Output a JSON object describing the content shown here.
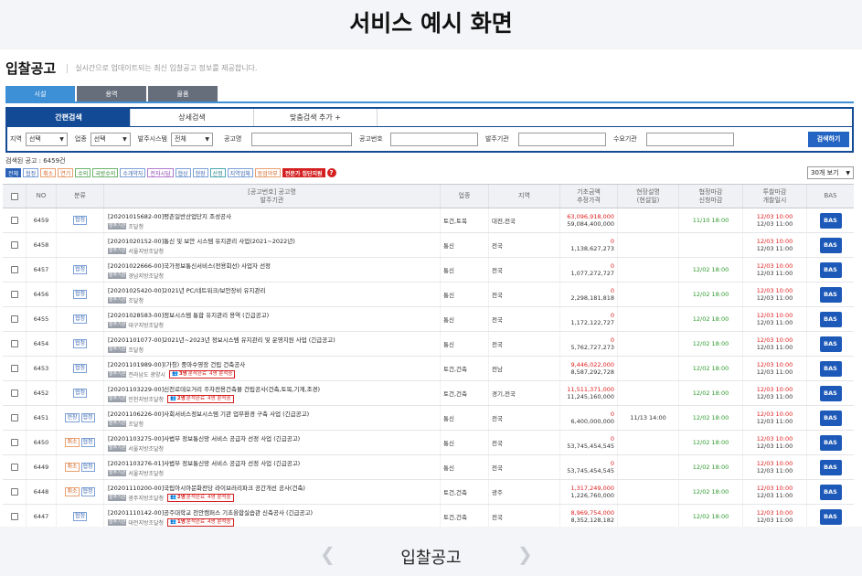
{
  "banner_title": "서비스 예시 화면",
  "page": {
    "title": "입찰공고",
    "description": "실시간으로 업데이트되는 최신 입찰공고 정보를 제공합니다."
  },
  "category_tabs": [
    "시설",
    "용역",
    "물품"
  ],
  "search_tabs": [
    "간편검색",
    "상세검색",
    "맞춤검색 추가 +"
  ],
  "filters": {
    "region_label": "지역",
    "region_value": "선택",
    "industry_label": "업종",
    "industry_value": "선택",
    "method_label": "발주시스템",
    "method_value": "전체",
    "notice_name_label": "공고명",
    "notice_no_label": "공고번호",
    "agency_label": "발주기관",
    "demand_label": "수요기관",
    "search_button": "검색하기"
  },
  "count_text": "검색된 공고 : 6459건",
  "chips": [
    "전체",
    "협정",
    "취소",
    "연기",
    "수의",
    "국방수의",
    "수개약자",
    "전자시담",
    "협상",
    "현장",
    "산정",
    "지역업체",
    "등업야부"
  ],
  "expert_chip": "전문가 집단지원",
  "qmark": "?",
  "per_page": "30개 보기",
  "table": {
    "headers": {
      "no": "NO",
      "category": "분류",
      "title_line1": "[공고번호] 공고명",
      "title_line2": "발주기관",
      "industry": "업종",
      "region": "지역",
      "price_line1": "기초금액",
      "price_line2": "추정가격",
      "site_line1": "현장설명",
      "site_line2": "(현설일)",
      "date_line1": "협정마감",
      "date_line2": "신청마감",
      "bid_line1": "투찰마감",
      "bid_line2": "개찰일시",
      "bas": "BAS"
    },
    "agency_badge": "발주기관",
    "bas_label": "BAS",
    "rows": [
      {
        "no": "6459",
        "tags": [
          {
            "t": "협정",
            "c": ""
          }
        ],
        "title": "[20201015682-00]평촌일반산업단지 조성공사",
        "agency": "조달청",
        "badge": null,
        "industry": "토건,토목",
        "region": "대전,전국",
        "price1": "63,096,918,000",
        "price2": "59,084,400,000",
        "site": "",
        "date": "11/10 18:00",
        "bid1": "12/03 10:00",
        "bid2": "12/03 11:00"
      },
      {
        "no": "6458",
        "tags": [],
        "title": "[20201020152-00]통신 및 보안 시스템 유지관리 사업(2021~2022년)",
        "agency": "서울지방조달청",
        "badge": null,
        "industry": "통신",
        "region": "전국",
        "price1": "0",
        "price2": "1,138,627,273",
        "site": "",
        "date": "",
        "bid1": "12/03 10:00",
        "bid2": "12/03 11:00"
      },
      {
        "no": "6457",
        "tags": [
          {
            "t": "협정",
            "c": ""
          }
        ],
        "title": "[20201022666-00]국가정보통신서비스(전용회선) 사업자 선정",
        "agency": "경남지방조달청",
        "badge": null,
        "industry": "통신",
        "region": "전국",
        "price1": "0",
        "price2": "1,077,272,727",
        "site": "",
        "date": "12/02 18:00",
        "bid1": "12/03 10:00",
        "bid2": "12/03 11:00"
      },
      {
        "no": "6456",
        "tags": [
          {
            "t": "협정",
            "c": ""
          }
        ],
        "title": "[20201025420-00]2021년 PC/네트워크/보안장비 유지관리",
        "agency": "조달청",
        "badge": null,
        "industry": "통신",
        "region": "전국",
        "price1": "0",
        "price2": "2,298,181,818",
        "site": "",
        "date": "12/02 18:00",
        "bid1": "12/03 10:00",
        "bid2": "12/03 11:00"
      },
      {
        "no": "6455",
        "tags": [
          {
            "t": "협정",
            "c": ""
          }
        ],
        "title": "[20201028583-00]정보시스템 통합 유지관리 용역 (긴급공고)",
        "agency": "대구지방조달청",
        "badge": null,
        "industry": "통신",
        "region": "전국",
        "price1": "0",
        "price2": "1,172,122,727",
        "site": "",
        "date": "12/02 18:00",
        "bid1": "12/03 10:00",
        "bid2": "12/03 11:00"
      },
      {
        "no": "6454",
        "tags": [
          {
            "t": "협정",
            "c": ""
          }
        ],
        "title": "[20201101077-00]2021년~2023년 정보시스템 유지관리 및 운영지원 사업 (긴급공고)",
        "agency": "조달청",
        "badge": null,
        "industry": "통신",
        "region": "전국",
        "price1": "0",
        "price2": "5,762,727,273",
        "site": "",
        "date": "12/02 18:00",
        "bid1": "12/03 10:00",
        "bid2": "12/03 11:00"
      },
      {
        "no": "6453",
        "tags": [
          {
            "t": "협정",
            "c": ""
          }
        ],
        "title": "[20201101989-00](가칭) 중마수영장 건립 건축공사",
        "agency": "전라남도 광양시",
        "badge": {
          "count": "3명",
          "a": "분석완료",
          "b": "4명 분석중"
        },
        "industry": "토건,건축",
        "region": "전남",
        "price1": "9,446,022,000",
        "price2": "8,587,292,728",
        "site": "",
        "date": "12/02 18:00",
        "bid1": "12/03 10:00",
        "bid2": "12/03 11:00"
      },
      {
        "no": "6452",
        "tags": [
          {
            "t": "협정",
            "c": ""
          }
        ],
        "title": "[20201103229-00]신천로데오거리 주차전용건축물 건립공사(건축,토목,기계,조경)",
        "agency": "인천지방조달청",
        "badge": {
          "count": "2명",
          "a": "분석완료",
          "b": "4명 분석중"
        },
        "industry": "토건,건축",
        "region": "경기,전국",
        "price1": "11,511,371,000",
        "price2": "11,245,160,000",
        "site": "",
        "date": "12/02 18:00",
        "bid1": "12/03 10:00",
        "bid2": "12/03 11:00"
      },
      {
        "no": "6451",
        "tags": [
          {
            "t": "현장",
            "c": ""
          },
          {
            "t": "협정",
            "c": ""
          }
        ],
        "title": "[20201106226-00]사회서비스정보시스템 기관 업무환경 구축 사업 (긴급공고)",
        "agency": "조달청",
        "badge": null,
        "industry": "통신",
        "region": "전국",
        "price1": "0",
        "price2": "6,400,000,000",
        "site": "11/13 14:00",
        "date": "12/02 18:00",
        "bid1": "12/03 10:00",
        "bid2": "12/03 11:00"
      },
      {
        "no": "6450",
        "tags": [
          {
            "t": "취소",
            "c": "orange"
          },
          {
            "t": "협정",
            "c": ""
          }
        ],
        "title": "[20201103275-00]사법부 정보통신망 서비스 공급자 선정 사업 (긴급공고)",
        "agency": "서울지방조달청",
        "badge": null,
        "industry": "통신",
        "region": "전국",
        "price1": "0",
        "price2": "53,745,454,545",
        "site": "",
        "date": "12/02 18:00",
        "bid1": "12/03 10:00",
        "bid2": "12/03 11:00"
      },
      {
        "no": "6449",
        "tags": [
          {
            "t": "취소",
            "c": "orange"
          },
          {
            "t": "협정",
            "c": ""
          }
        ],
        "title": "[20201103276-01]사법부 정보통신망 서비스 공급자 선정 사업 (긴급공고)",
        "agency": "서울지방조달청",
        "badge": null,
        "industry": "통신",
        "region": "전국",
        "price1": "0",
        "price2": "53,745,454,545",
        "site": "",
        "date": "12/02 18:00",
        "bid1": "12/03 10:00",
        "bid2": "12/03 11:00"
      },
      {
        "no": "6448",
        "tags": [
          {
            "t": "취소",
            "c": "orange"
          },
          {
            "t": "협정",
            "c": ""
          }
        ],
        "title": "[20201110200-00]국립아시아문화전당 라이브러리파크 공간개선 공사(건축)",
        "agency": "광주지방조달청",
        "badge": {
          "count": "2명",
          "a": "분석완료",
          "b": "4명 분석중"
        },
        "industry": "토건,건축",
        "region": "광주",
        "price1": "1,317,249,000",
        "price2": "1,226,760,000",
        "site": "",
        "date": "12/02 18:00",
        "bid1": "12/03 10:00",
        "bid2": "12/03 11:00"
      },
      {
        "no": "6447",
        "tags": [
          {
            "t": "협정",
            "c": ""
          }
        ],
        "title": "[20201110142-00]공주대학교 천안캠퍼스 기초융합실습관 신축공사 (긴급공고)",
        "agency": "대전지방조달청",
        "badge": {
          "count": "1명",
          "a": "분석완료",
          "b": "4명 분석중"
        },
        "industry": "토건,건축",
        "region": "전국",
        "price1": "8,969,754,000",
        "price2": "8,352,128,182",
        "site": "",
        "date": "12/02 18:00",
        "bid1": "12/03 10:00",
        "bid2": "12/03 11:00"
      }
    ]
  },
  "bottom_nav": {
    "prev": "❮",
    "label": "입찰공고",
    "next": "❯"
  }
}
